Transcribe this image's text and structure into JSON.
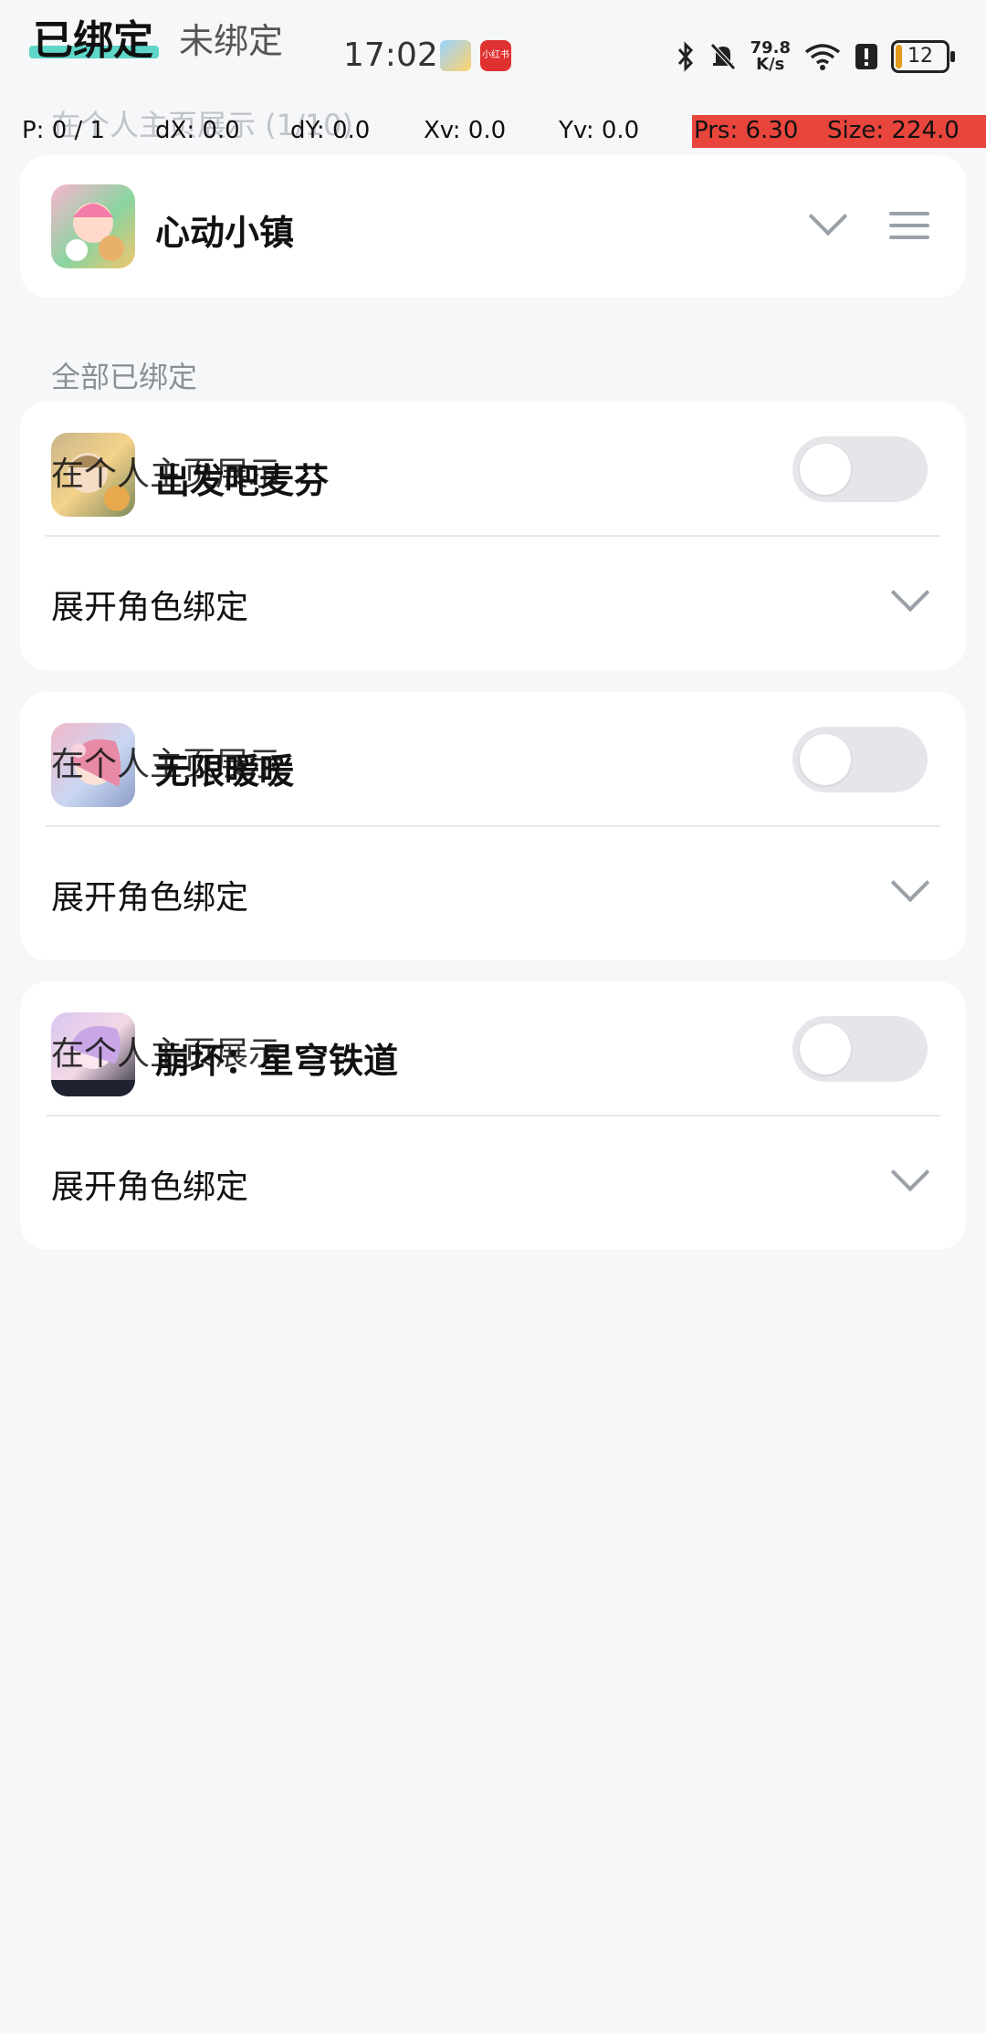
{
  "status": {
    "tabs": {
      "bound": "已绑定",
      "unbound": "未绑定"
    },
    "time": "17:02",
    "badge2": "小红书",
    "net_speed_value": "79.8",
    "net_speed_unit": "K/s",
    "battery": "12",
    "battery_level": 0.12
  },
  "debug": {
    "p": "P: 0 / 1",
    "dx": "dX: 0.0",
    "dy": "dY: 0.0",
    "xv": "Xv: 0.0",
    "yv": "Yv: 0.0",
    "prs": "Prs: 6.30",
    "size": "Size: 224.0"
  },
  "ghost_header": "在个人主页展示 (1/10)",
  "pinned": {
    "name": "心动小镇"
  },
  "section_label": "全部已绑定",
  "games": [
    {
      "name": "出发吧麦芬",
      "ghost": "在个人主页展示",
      "expand": "展开角色绑定",
      "enabled": false
    },
    {
      "name": "无限暖暖",
      "ghost": "在个人主页展示",
      "expand": "展开角色绑定",
      "enabled": false
    },
    {
      "name": "崩坏：星穹铁道",
      "ghost": "在个人主页展示",
      "expand": "展开角色绑定",
      "enabled": false
    }
  ],
  "colors": {
    "accent": "#43d0c0",
    "debug_red": "#e8453c",
    "toggle_off": "#e4e6ea"
  }
}
